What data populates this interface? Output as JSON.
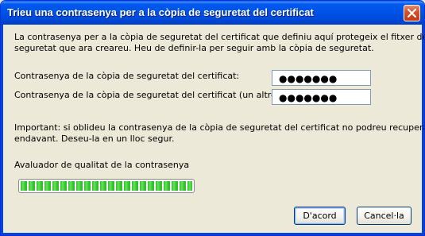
{
  "window": {
    "title": "Trieu una contrasenya per a la còpia de seguretat del certificat",
    "close_icon": "close-icon"
  },
  "intro": {
    "line1": "La contrasenya per a la còpia de seguretat del certificat que definiu aquí protegeix el fitxer de còpia de",
    "line2": "seguretat que ara creareu. Heu de definir-la per seguir amb la còpia de seguretat."
  },
  "fields": {
    "password_label": "Contrasenya de la còpia de seguretat del certificat:",
    "password_value": "●●●●●●●",
    "confirm_label": "Contrasenya de la còpia de seguretat del certificat (un altre cop):",
    "confirm_value": "●●●●●●●"
  },
  "warning": {
    "line1": "Important: si oblideu la contrasenya de la còpia de seguretat del certificat no podreu recuperar-la més",
    "line2": "endavant. Deseu-la en un lloc segur."
  },
  "meter": {
    "label": "Avaluador de qualitat de la contrasenya",
    "level": 1.0,
    "color": "#2fc02a"
  },
  "buttons": {
    "ok_label": "D'acord",
    "cancel_label": "Cancel·la"
  }
}
